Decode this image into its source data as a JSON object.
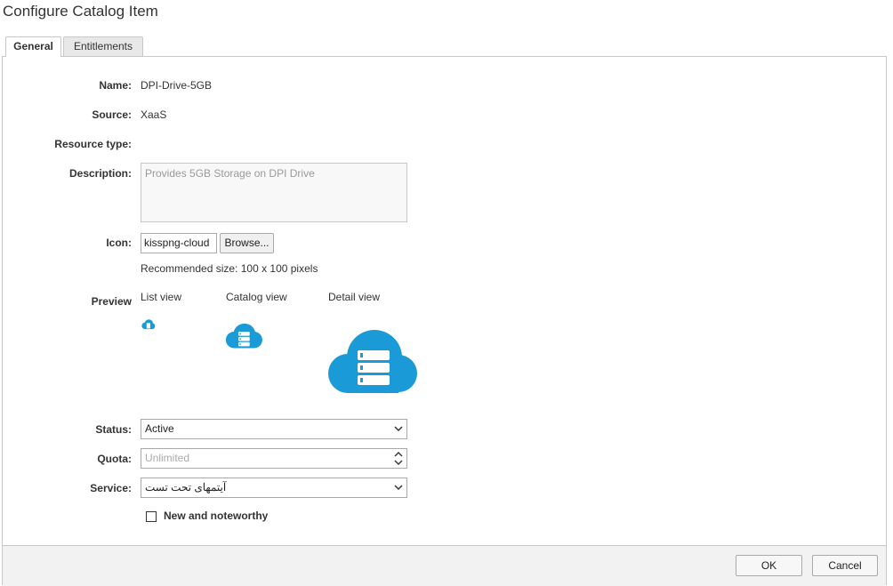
{
  "title": "Configure Catalog Item",
  "tabs": [
    {
      "label": "General",
      "active": true
    },
    {
      "label": "Entitlements",
      "active": false
    }
  ],
  "form": {
    "name_label": "Name:",
    "name_value": "DPI-Drive-5GB",
    "source_label": "Source:",
    "source_value": "XaaS",
    "resource_type_label": "Resource type:",
    "description_label": "Description:",
    "description_value": "Provides 5GB Storage on DPI Drive",
    "icon_label": "Icon:",
    "icon_file": "kisspng-cloud",
    "browse_label": "Browse...",
    "recommended_size": "Recommended size: 100 x 100 pixels",
    "preview_label": "Preview",
    "preview_list": "List view",
    "preview_catalog": "Catalog view",
    "preview_detail": "Detail view",
    "status_label": "Status:",
    "status_value": "Active",
    "quota_label": "Quota:",
    "quota_placeholder": "Unlimited",
    "service_label": "Service:",
    "service_value": "آیتمهای تحت تست",
    "new_noteworthy_label": "New and noteworthy",
    "new_noteworthy_checked": false
  },
  "footer": {
    "ok_label": "OK",
    "cancel_label": "Cancel"
  },
  "colors": {
    "cloud_icon": "#1a9ad6"
  }
}
